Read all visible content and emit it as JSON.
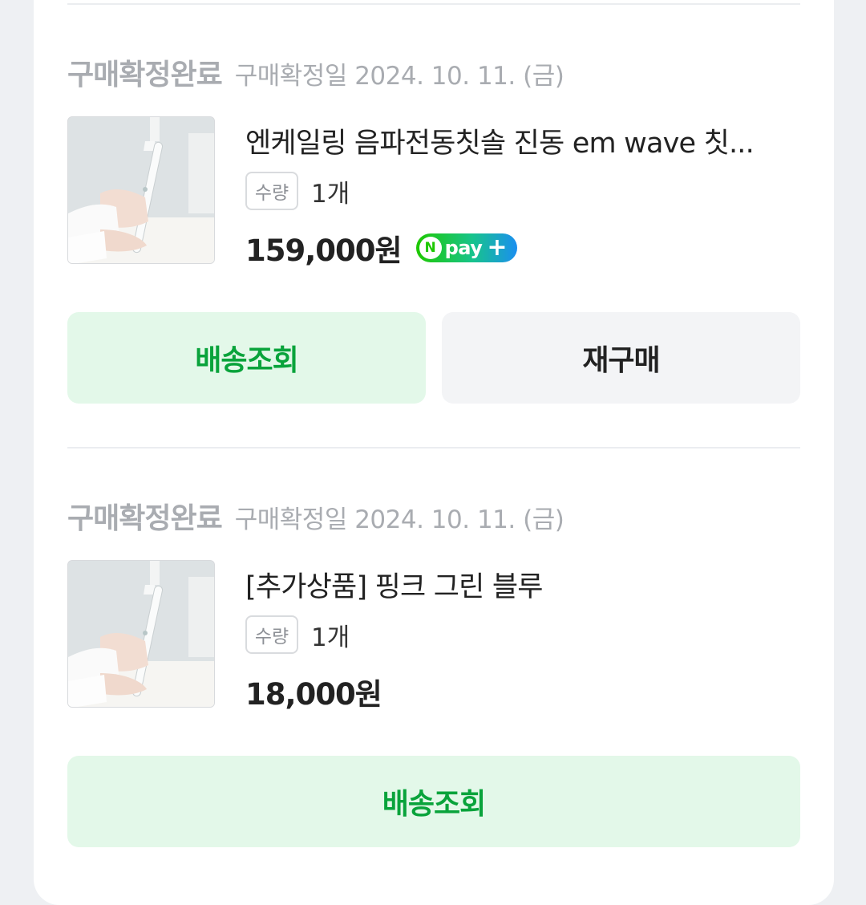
{
  "orders": [
    {
      "status": "구매확정완료",
      "date": "구매확정일 2024. 10. 11. (금)",
      "product_name": "엔케일링 음파전동칫솔 진동 em wave 칫솔 화이트",
      "product_name_display": "엔케일링 음파전동칫솔 진동 em wave 칫...",
      "qty_label": "수량",
      "qty_value": "1개",
      "price": "159,000원",
      "badge": {
        "n": "N",
        "text": "pay",
        "plus": "+"
      },
      "buttons": {
        "track": "배송조회",
        "reorder": "재구매"
      }
    },
    {
      "status": "구매확정완료",
      "date": "구매확정일 2024. 10. 11. (금)",
      "product_name": "[추가상품] 핑크 그린 블루",
      "qty_label": "수량",
      "qty_value": "1개",
      "price": "18,000원",
      "buttons": {
        "track": "배송조회"
      }
    }
  ],
  "colors": {
    "accent_green": "#09a33b",
    "green_bg": "#e3f8e9",
    "gray_bg": "#f3f4f6",
    "muted": "#a9acb1"
  },
  "icons": {
    "pay_badge": "npay-plus-badge",
    "thumbnail": "toothbrush-product-image"
  }
}
